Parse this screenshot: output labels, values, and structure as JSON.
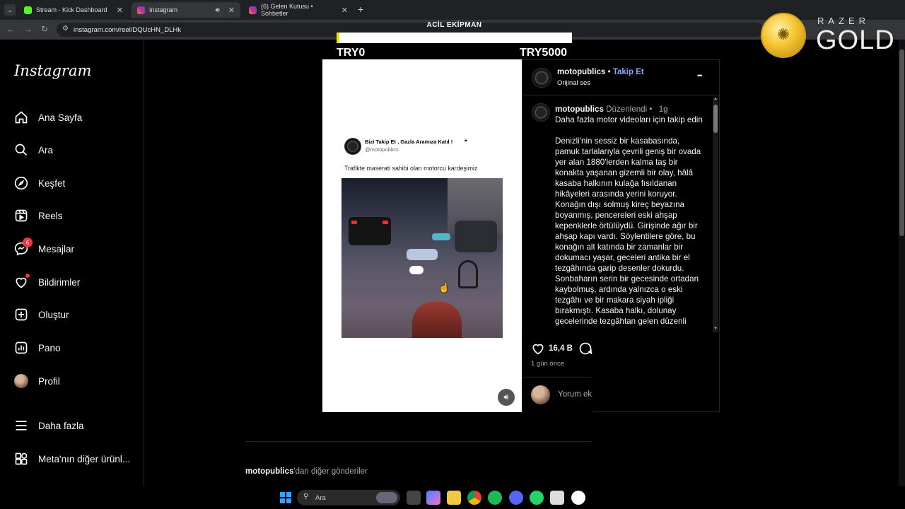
{
  "browser": {
    "tabs": [
      {
        "label": "Stream - Kick Dashboard",
        "active": false,
        "favicon_color": "#53fc18"
      },
      {
        "label": "Instagram",
        "active": true,
        "favicon_color": "#d6249f"
      },
      {
        "label": "(6) Gelen Kutusu • Sohbetler",
        "active": false,
        "favicon_color": "#d6249f"
      }
    ],
    "new_tab": "+",
    "url": "instagram.com/reel/DQUcHN_DLHk"
  },
  "overlay": {
    "title": "ACİL EKİPMAN",
    "min_value": "TRY0",
    "max_value": "TRY5000",
    "progress": 0.01,
    "sponsor_top": "RAZER",
    "sponsor_bottom": "GOLD"
  },
  "instagram": {
    "logo": "Instagram",
    "nav": [
      {
        "label": "Ana Sayfa",
        "icon": "home-icon"
      },
      {
        "label": "Ara",
        "icon": "search-icon"
      },
      {
        "label": "Keşfet",
        "icon": "compass-icon"
      },
      {
        "label": "Reels",
        "icon": "reels-icon"
      },
      {
        "label": "Mesajlar",
        "icon": "messenger-icon",
        "badge": "6"
      },
      {
        "label": "Bildirimler",
        "icon": "heart-icon"
      },
      {
        "label": "Oluştur",
        "icon": "plus-square-icon"
      },
      {
        "label": "Pano",
        "icon": "dashboard-icon"
      },
      {
        "label": "Profil",
        "icon": "profile-avatar"
      },
      {
        "label": "Daha fazla",
        "icon": "menu-icon"
      },
      {
        "label": "Meta'nın diğer ürünl...",
        "icon": "meta-apps-icon"
      }
    ],
    "post": {
      "tweet": {
        "name": "Bizi Takip Et , Gazla Aramıza Katıl !",
        "handle": "@motopublics",
        "text": "Trafikte maserati sahibi olan motorcu kardeşimiz"
      },
      "header": {
        "username": "motopublics",
        "separator": "•",
        "follow": "Takip Et",
        "audio": "Orijinal ses",
        "more": "•••"
      },
      "caption_user": "motopublics",
      "caption_edited": "Düzenlendi",
      "caption_time": "1g",
      "caption_text": "Daha fazla motor videoları için takip edin\n\nDenizli'nin sessiz bir kasabasında, pamuk tarlalarıyla çevrili geniş bir ovada yer alan 1880'lerden kalma taş bir konakta yaşanan gizemli bir olay, hâlâ kasaba halkının kulağa fısıldanan hikâyeleri arasında yerini koruyor.\nKonağın dışı solmuş kireç beyazına boyanmış, pencereleri eski ahşap kepenklerle örtülüydü. Girişinde ağır bir ahşap kapı vardı. Söylentilere göre, bu konağın alt katında bir zamanlar bir dokumacı yaşar, geceleri antika bir el tezgâhında garip desenler dokurdu.\nSonbaharın serin bir gecesinde ortadan kaybolmuş, ardında yalnızca o eski tezgâhı ve bir makara siyah ipliği bırakmıştı. Kasaba halkı, dolunay gecelerinde tezgâhtan gelen düzenli",
      "likes": "16,4 B",
      "date": "1 gün önce",
      "comment_placeholder": "Yorum ek"
    },
    "more_posts_user": "motopublics",
    "more_posts_suffix": "'dan diğer gönderiler"
  },
  "taskbar": {
    "search_label": "Ara"
  }
}
